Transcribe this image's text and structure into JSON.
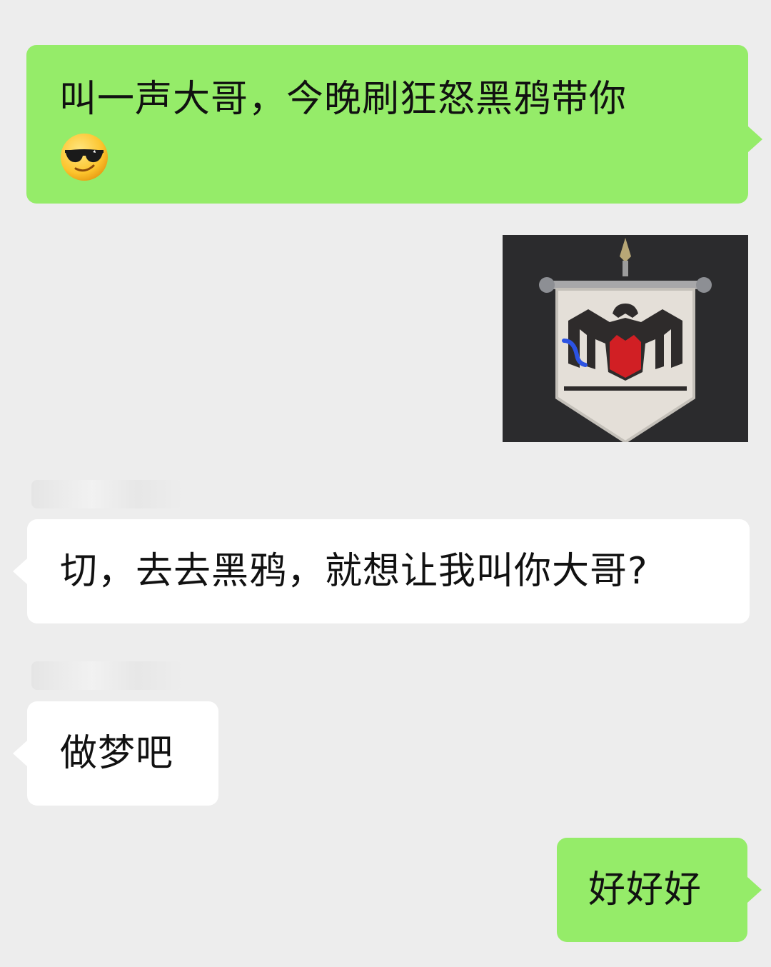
{
  "messages": [
    {
      "id": "msg1",
      "direction": "outgoing",
      "text": "叫一声大哥，今晚刷狂怒黑鸦带你",
      "emoji": "smiling-face-with-sunglasses-emoji"
    },
    {
      "id": "msg-image",
      "direction": "outgoing",
      "type": "image",
      "image": "black-crow-banner-emblem"
    },
    {
      "id": "msg2",
      "direction": "incoming",
      "text": "切，去去黑鸦，就想让我叫你大哥?"
    },
    {
      "id": "msg3",
      "direction": "incoming",
      "text": "做梦吧"
    },
    {
      "id": "msg4",
      "direction": "outgoing",
      "text": "好好好"
    }
  ],
  "colors": {
    "background": "#ededed",
    "outgoing_bubble": "#95ec69",
    "incoming_bubble": "#ffffff",
    "text": "#111111",
    "banner_red": "#d11f24",
    "banner_bg": "#2b2b2d"
  }
}
